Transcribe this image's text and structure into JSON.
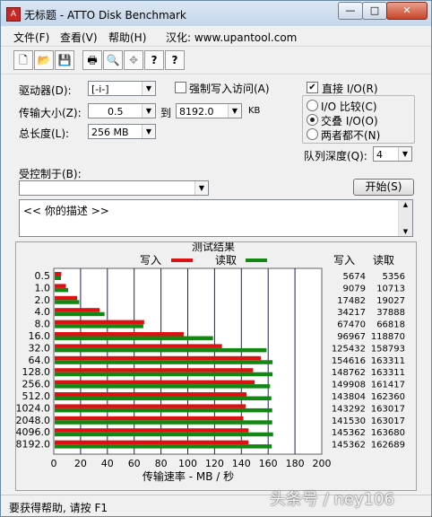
{
  "window": {
    "title": "无标题 - ATTO Disk Benchmark",
    "minimize": "—",
    "maximize": "□",
    "close": "✕",
    "icon": "atto-logo-icon"
  },
  "menu": {
    "file": "文件(F)",
    "view": "查看(V)",
    "help": "帮助(H)",
    "localized": "汉化: www.upantool.com"
  },
  "toolbar": {
    "new": "🗋",
    "open": "📂",
    "save": "💾",
    "print": "🖶",
    "preview": "🔍",
    "move": "✥",
    "help": "?",
    "context_help": "?"
  },
  "settings": {
    "drive_label": "驱动器(D):",
    "drive_value": "[-i-]",
    "transfer_label": "传输大小(Z):",
    "transfer_from": "0.5",
    "to_label": "到",
    "transfer_to": "8192.0",
    "kb_label": "KB",
    "length_label": "总长度(L):",
    "length_value": "256 MB",
    "force_write_label": "强制写入访问(A)",
    "force_write_checked": false,
    "direct_io_label": "直接 I/O(R)",
    "direct_io_checked": true,
    "io_compare_label": "I/O 比较(C)",
    "overlap_io_label": "交叠 I/O(O)",
    "neither_label": "两者都不(N)",
    "queue_label": "队列深度(Q):",
    "queue_value": "4",
    "controlled_by_label": "受控制于(B):",
    "controlled_by_value": "",
    "start_label": "开始(S)",
    "description": "<<  你的描述  >>"
  },
  "results": {
    "title": "测试结果",
    "write_legend": "写入",
    "read_legend": "读取",
    "write_col": "写入",
    "read_col": "读取",
    "xaxis_label": "传输速率 - MB / 秒",
    "write_color": "#dd1111",
    "read_color": "#118811"
  },
  "chart_data": {
    "type": "bar",
    "orientation": "horizontal",
    "categories": [
      "0.5",
      "1.0",
      "2.0",
      "4.0",
      "8.0",
      "16.0",
      "32.0",
      "64.0",
      "128.0",
      "256.0",
      "512.0",
      "1024.0",
      "2048.0",
      "4096.0",
      "8192.0"
    ],
    "series": [
      {
        "name": "写入",
        "values": [
          5.674,
          9.079,
          17.482,
          34.217,
          67.47,
          96.967,
          125.532,
          154.616,
          148.762,
          149.908,
          143.804,
          143.292,
          141.53,
          145.362,
          145.362
        ]
      },
      {
        "name": "读取",
        "values": [
          5.356,
          10.713,
          19.027,
          37.888,
          66.818,
          118.87,
          158.793,
          163.311,
          163.311,
          161.417,
          162.36,
          163.017,
          163.017,
          163.68,
          162.689
        ]
      }
    ],
    "write_kb": [
      "5674",
      "9079",
      "17482",
      "34217",
      "67470",
      "96967",
      "125432",
      "154616",
      "148762",
      "149908",
      "143804",
      "143292",
      "141530",
      "145362",
      "145362"
    ],
    "read_kb": [
      "5356",
      "10713",
      "19027",
      "37888",
      "66818",
      "118870",
      "158793",
      "163311",
      "163311",
      "161417",
      "162360",
      "163017",
      "163017",
      "163680",
      "162689"
    ],
    "xticks": [
      "0",
      "20",
      "40",
      "60",
      "80",
      "100",
      "120",
      "140",
      "160",
      "180",
      "200"
    ],
    "xlim": [
      0,
      200
    ],
    "xlabel": "传输速率 - MB / 秒"
  },
  "status": "要获得帮助, 请按 F1",
  "watermark": "头条号 / ney106"
}
